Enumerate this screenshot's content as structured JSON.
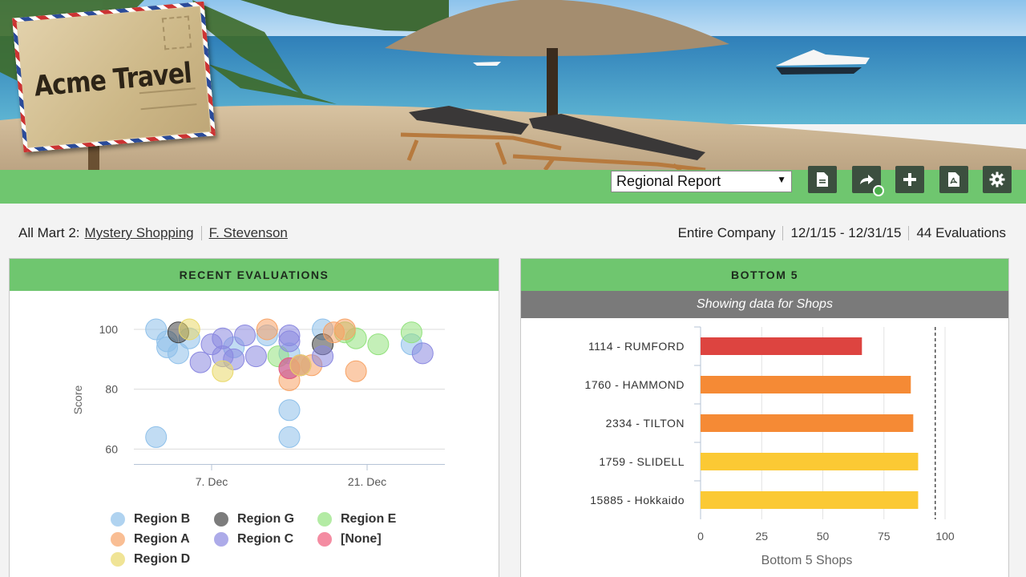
{
  "brand": {
    "title": "Acme Travel"
  },
  "toolbar": {
    "report_select_value": "Regional Report",
    "buttons": [
      "document-icon",
      "share-icon",
      "plus-icon",
      "pdf-icon",
      "gear-icon"
    ]
  },
  "breadcrumb": {
    "prefix": "All Mart 2:",
    "link1": "Mystery Shopping",
    "link2": "F. Stevenson"
  },
  "summary": {
    "scope": "Entire Company",
    "date_range": "12/1/15 - 12/31/15",
    "evaluations": "44 Evaluations"
  },
  "recent_panel": {
    "title": "RECENT EVALUATIONS",
    "legend": [
      {
        "name": "Region B",
        "color": "#8ec0ea"
      },
      {
        "name": "Region G",
        "color": "#444444"
      },
      {
        "name": "Region E",
        "color": "#93e27e"
      },
      {
        "name": "Region A",
        "color": "#f7a366"
      },
      {
        "name": "Region C",
        "color": "#8a88e0"
      },
      {
        "name": "[None]",
        "color": "#ef5b7a"
      },
      {
        "name": "Region D",
        "color": "#e9d96a"
      }
    ]
  },
  "bottom_panel": {
    "title": "BOTTOM 5",
    "subtitle": "Showing data for Shops"
  },
  "chart_data": [
    {
      "type": "scatter",
      "ylabel": "Score",
      "xlabel": "",
      "ylim": [
        55,
        100
      ],
      "x_ticks": [
        "7. Dec",
        "21. Dec"
      ],
      "y_ticks": [
        60,
        80,
        100
      ],
      "series": [
        {
          "name": "Region B",
          "color": "#8ec0ea",
          "points": [
            [
              2,
              100
            ],
            [
              3,
              96
            ],
            [
              3,
              94
            ],
            [
              4,
              92
            ],
            [
              5,
              97
            ],
            [
              9,
              94
            ],
            [
              14,
              92
            ],
            [
              14,
              73
            ],
            [
              14,
              64
            ],
            [
              17,
              100
            ],
            [
              25,
              95
            ],
            [
              2,
              64
            ],
            [
              12,
              98
            ]
          ]
        },
        {
          "name": "Region G",
          "color": "#444444",
          "points": [
            [
              4,
              99
            ],
            [
              17,
              95
            ]
          ]
        },
        {
          "name": "Region E",
          "color": "#93e27e",
          "points": [
            [
              20,
              97
            ],
            [
              22,
              95
            ],
            [
              25,
              99
            ],
            [
              13,
              91
            ],
            [
              19,
              99
            ]
          ]
        },
        {
          "name": "Region A",
          "color": "#f7a366",
          "points": [
            [
              12,
              100
            ],
            [
              14,
              83
            ],
            [
              16,
              88
            ],
            [
              18,
              99
            ],
            [
              20,
              86
            ],
            [
              19,
              100
            ]
          ]
        },
        {
          "name": "Region C",
          "color": "#8a88e0",
          "points": [
            [
              6,
              89
            ],
            [
              7,
              95
            ],
            [
              8,
              97
            ],
            [
              8,
              91
            ],
            [
              9,
              90
            ],
            [
              10,
              98
            ],
            [
              11,
              91
            ],
            [
              14,
              98
            ],
            [
              14,
              96
            ],
            [
              15,
              88
            ],
            [
              17,
              91
            ],
            [
              26,
              92
            ],
            [
              14,
              87
            ]
          ]
        },
        {
          "name": "[None]",
          "color": "#ef5b7a",
          "points": [
            [
              14,
              87
            ],
            [
              15,
              88
            ]
          ]
        },
        {
          "name": "Region D",
          "color": "#e9d96a",
          "points": [
            [
              5,
              100
            ],
            [
              8,
              86
            ],
            [
              15,
              88
            ]
          ]
        }
      ],
      "x_range": [
        0,
        28
      ],
      "x_tick_positions": [
        7,
        21
      ]
    },
    {
      "type": "bar",
      "orientation": "horizontal",
      "xlabel": "Bottom 5 Shops",
      "ylabel": "",
      "xlim": [
        0,
        100
      ],
      "x_ticks": [
        0,
        25,
        50,
        75,
        100
      ],
      "reference_line": 96,
      "categories": [
        "1114 - RUMFORD",
        "1760 - HAMMOND",
        "2334 - TILTON",
        "1759 - SLIDELL",
        "15885 - Hokkaido"
      ],
      "values": [
        66,
        86,
        87,
        89,
        89
      ],
      "colors": [
        "#dd4440",
        "#f58a35",
        "#f58a35",
        "#fbc934",
        "#fbc934"
      ]
    }
  ]
}
